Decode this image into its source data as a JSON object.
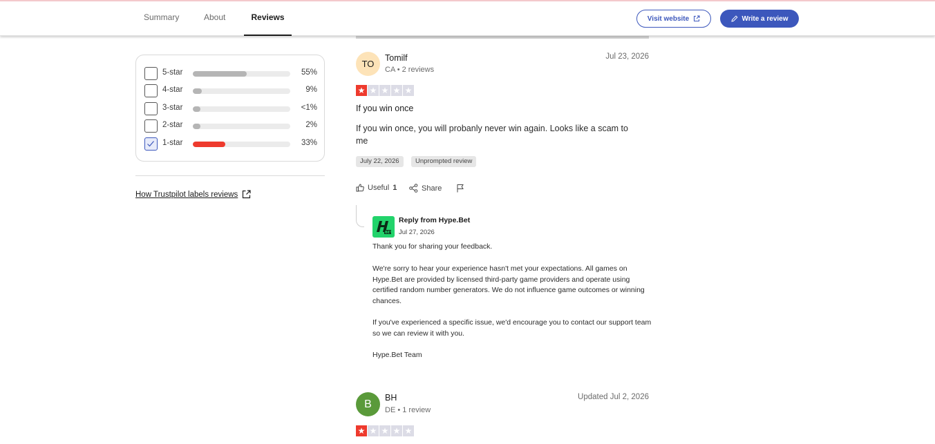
{
  "nav": {
    "tabs": [
      {
        "label": "Summary",
        "active": false
      },
      {
        "label": "About",
        "active": false
      },
      {
        "label": "Reviews",
        "active": true
      }
    ],
    "visit_website": "Visit website",
    "write_review": "Write a review",
    "accent_color": "#3c57bc"
  },
  "filters": {
    "rows": [
      {
        "label": "5-star",
        "percent_text": "55%",
        "fill_fraction": 0.55,
        "checked": false
      },
      {
        "label": "4-star",
        "percent_text": "9%",
        "fill_fraction": 0.09,
        "checked": false
      },
      {
        "label": "3-star",
        "percent_text": "<1%",
        "fill_fraction": 0.01,
        "checked": false
      },
      {
        "label": "2-star",
        "percent_text": "2%",
        "fill_fraction": 0.02,
        "checked": false
      },
      {
        "label": "1-star",
        "percent_text": "33%",
        "fill_fraction": 0.33,
        "checked": true
      }
    ],
    "how_link": "How Trustpilot labels reviews"
  },
  "reviews": [
    {
      "initials": "TO",
      "avatar_color": "#fde3b8",
      "name": "Tomilf",
      "meta": "CA • 2 reviews",
      "date": "Jul 23, 2026",
      "rating": 1,
      "title": "If you win once",
      "body": "If you win once, you will probanly never win again. Looks like a scam to me",
      "experience_date": "July 22, 2026",
      "tag": "Unprompted review",
      "useful_label": "Useful",
      "useful_count": "1",
      "share_label": "Share",
      "reply": {
        "from": "Reply from Hype.Bet",
        "date": "Jul 27, 2026",
        "logo_color": "#22d36b",
        "paragraphs": [
          "Thank you for sharing your feedback.",
          "We're sorry to hear your experience hasn't met your expectations. All games on Hype.Bet are provided by licensed third-party game providers and operate using certified random number generators. We do not influence game outcomes or winning chances.",
          "If you've experienced a specific issue, we'd encourage you to contact our support team so we can review it with you.",
          "Hype.Bet Team"
        ]
      }
    },
    {
      "initials": "B",
      "avatar_color": "#5a9a3a",
      "name": "BH",
      "meta": "DE • 1 review",
      "date": "Updated Jul 2, 2026",
      "rating": 1
    }
  ],
  "star_on_color": "#ee3a2d"
}
